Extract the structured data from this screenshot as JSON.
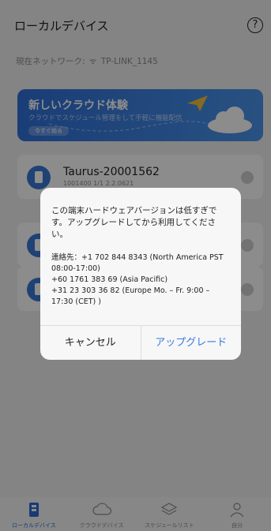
{
  "header": {
    "title": "ローカルデバイス",
    "help_glyph": "?"
  },
  "network": {
    "label": "現在ネットワーク:",
    "ssid": "TP-LINK_1145",
    "wifi_glyph": "ᯤ"
  },
  "banner": {
    "title": "新しいクラウド体験",
    "subtitle": "クラウドでスケジュール管理をして手軽に機能配信",
    "button": "今すぐ始る"
  },
  "devices": [
    {
      "name": "Taurus-20001562",
      "sub": "1001400 1/1 2.2.0621"
    },
    {
      "name": "",
      "sub": ""
    },
    {
      "name": "",
      "sub": ""
    }
  ],
  "dialog": {
    "message": "この端末ハードウェアバージョンは低すぎです。アップグレードしてから利用してください。",
    "contact_line1": "連絡先：+1 702 844 8343 (North America PST 08:00-17:00)",
    "contact_line2": "+60 1761 383 69 (Asia Pacific)",
    "contact_line3": "+31 23 303 36 82 (Europe Mo. – Fr. 9:00 – 17:30 (CET) )",
    "cancel": "キャンセル",
    "upgrade": "アップグレード"
  },
  "tabs": [
    {
      "label": "ローカルデバイス",
      "icon": "device-icon",
      "active": true
    },
    {
      "label": "クラウドデバイス",
      "icon": "cloud-icon",
      "active": false
    },
    {
      "label": "スケジュールリスト",
      "icon": "layers-icon",
      "active": false
    },
    {
      "label": "自分",
      "icon": "person-icon",
      "active": false
    }
  ],
  "colors": {
    "accent": "#2d6bd6",
    "banner": "#3a82e2",
    "upgrade": "#3a7ae0"
  }
}
